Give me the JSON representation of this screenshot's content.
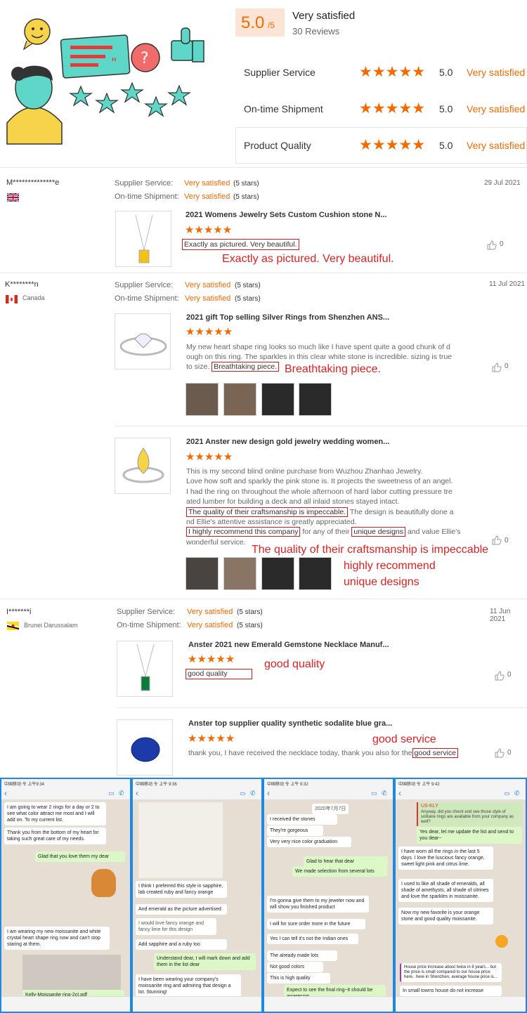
{
  "summary": {
    "score": "5.0",
    "score_suffix": "/5",
    "label": "Very satisfied",
    "reviews": "30 Reviews",
    "rows": [
      {
        "name": "Supplier Service",
        "value": "5.0",
        "label": "Very satisfied"
      },
      {
        "name": "On-time Shipment",
        "value": "5.0",
        "label": "Very satisfied"
      },
      {
        "name": "Product Quality",
        "value": "5.0",
        "label": "Very satisfied"
      }
    ]
  },
  "stars": "★★★★★",
  "labels": {
    "supplier_service": "Supplier Service:",
    "ontime_shipment": "On-time Shipment:",
    "very_satisfied": "Very satisfied",
    "five_stars": "(5 stars)"
  },
  "reviews": [
    {
      "user": "M**************e",
      "country": "",
      "date": "29 Jul 2021",
      "items": [
        {
          "title": "2021 Womens Jewelry Sets Custom Cushion stone N...",
          "highlight": "Exactly as pictured. Very beautiful.",
          "likes": "0",
          "note": "Exactly as pictured. Very beautiful."
        }
      ]
    },
    {
      "user": "K********n",
      "country": "Canada",
      "date": "11 Jul 2021",
      "items": [
        {
          "title": "2021 gift Top selling Silver Rings from Shenzhen ANS...",
          "text1": "My new heart shape ring looks so much like I have spent quite a good chunk of d",
          "text2": "ough on this ring. The sparkles in this clear white stone is incredible. sizing is true",
          "text3": "to size.",
          "highlight": "Breathtaking piece.",
          "likes": "0",
          "note": "Breathtaking piece."
        },
        {
          "title": "2021 Anster new design gold jewelry wedding women...",
          "lines": [
            "This is my second blind online purchase from Wuzhou Zhanhao Jewelry.",
            "Love how soft and sparkly the pink stone is. It projects the sweetness of an angel.",
            "I had the ring on throughout the whole afternoon of hard labor cutting pressure tre",
            "ated lumber for building a deck and all inlaid stones stayed intact."
          ],
          "hl1": "The quality of their craftsmanship is impeccable.",
          "after1": " The design is beautifully done a",
          "line6": "nd Ellie's attentive assistance is greatly appreciated.",
          "hl2": "I highly recommend this company",
          "mid2": " for any of their ",
          "hl3": "unique designs",
          "after3": " and value Ellie's",
          "line8": "wonderful service.",
          "likes": "0",
          "note1": "The quality of their craftsmanship is impeccable",
          "note2": "highly recommend",
          "note3": "unique designs"
        }
      ]
    },
    {
      "user": "I*******i",
      "country": "Brunei Darussalam",
      "date": "11 Jun 2021",
      "items": [
        {
          "title": "Anster 2021 new Emerald Gemstone Necklace Manuf...",
          "highlight": "good quality",
          "likes": "0",
          "note": "good quality"
        },
        {
          "title": "Anster top supplier quality synthetic sodalite blue gra...",
          "text": "thank you, I have received the necklace today, thank you also for the",
          "highlight": "good service",
          "likes": "0",
          "note": "good service"
        }
      ]
    }
  ],
  "chats": [
    {
      "status": "中国移动 令  上午9:34",
      "bubbles": [
        "I am going to wear 2 rings for a day or 2 to see what color attract me most and I will add on. To my current list.",
        "Thank you from the bottom of my heart for taking such great care of my needs.",
        "Glad that you love them my dear",
        "I am wearing my new moissanite and white crystal heart shape ring now and can't stop staring at them.",
        "Kelly-Moissanite ring-2ct.pdf"
      ]
    },
    {
      "status": "中国移动 令  上午 9:36",
      "bubbles": [
        "I think I preferred this style in sapphire, lab created ruby and fancy orange",
        "And emerald as the  picture advertised",
        "I would love fancy orange and fancy lime for this design",
        "Add sapphire and a ruby too",
        "Understand dear, I will mark down and add them in the list dear",
        "I have been wearing your company's moissanite ring and admiring that design a lot. Stunning!"
      ]
    },
    {
      "status": "中国移动 令  上午 9:32",
      "bubbles": [
        "2020年7月7日",
        "I received the stones",
        "They're gorgeous",
        "Very very nice color graduation",
        "Glad to hear that dear",
        "We made selection from several lots",
        "I'm gonna give them to my jeweler now and will show you finished product",
        "I will for sure order more in the future",
        "Yes I can tell it's not the Indian ones",
        "The already made lots",
        "Not good colors",
        "This is high quality",
        "Expect to see the final ring~it should be awaresom"
      ]
    },
    {
      "status": "中国移动 令  上午 9:42",
      "bubbles": [
        "US-KLY",
        "Anyway, did you check and see those style of solitaire rings are available from your company as well?",
        "Yes dear, let me update the list and send to you dear~",
        "I have worn all the rings in the last 5 days. I love the luscious fancy orange, sweet light pink and citrus lime.",
        "I used to like all shade of emeralds, all shade of amethysts, all shade of citrines and love the sparkles in moissanite.",
        "Now my new favorite is your orange stone and good quality moissanite.",
        "House price increase about twice in 6 years... but the price is small compared to our house price here.. here in Shenzhen, average house price is...",
        "In small towns house do not increase"
      ]
    }
  ]
}
